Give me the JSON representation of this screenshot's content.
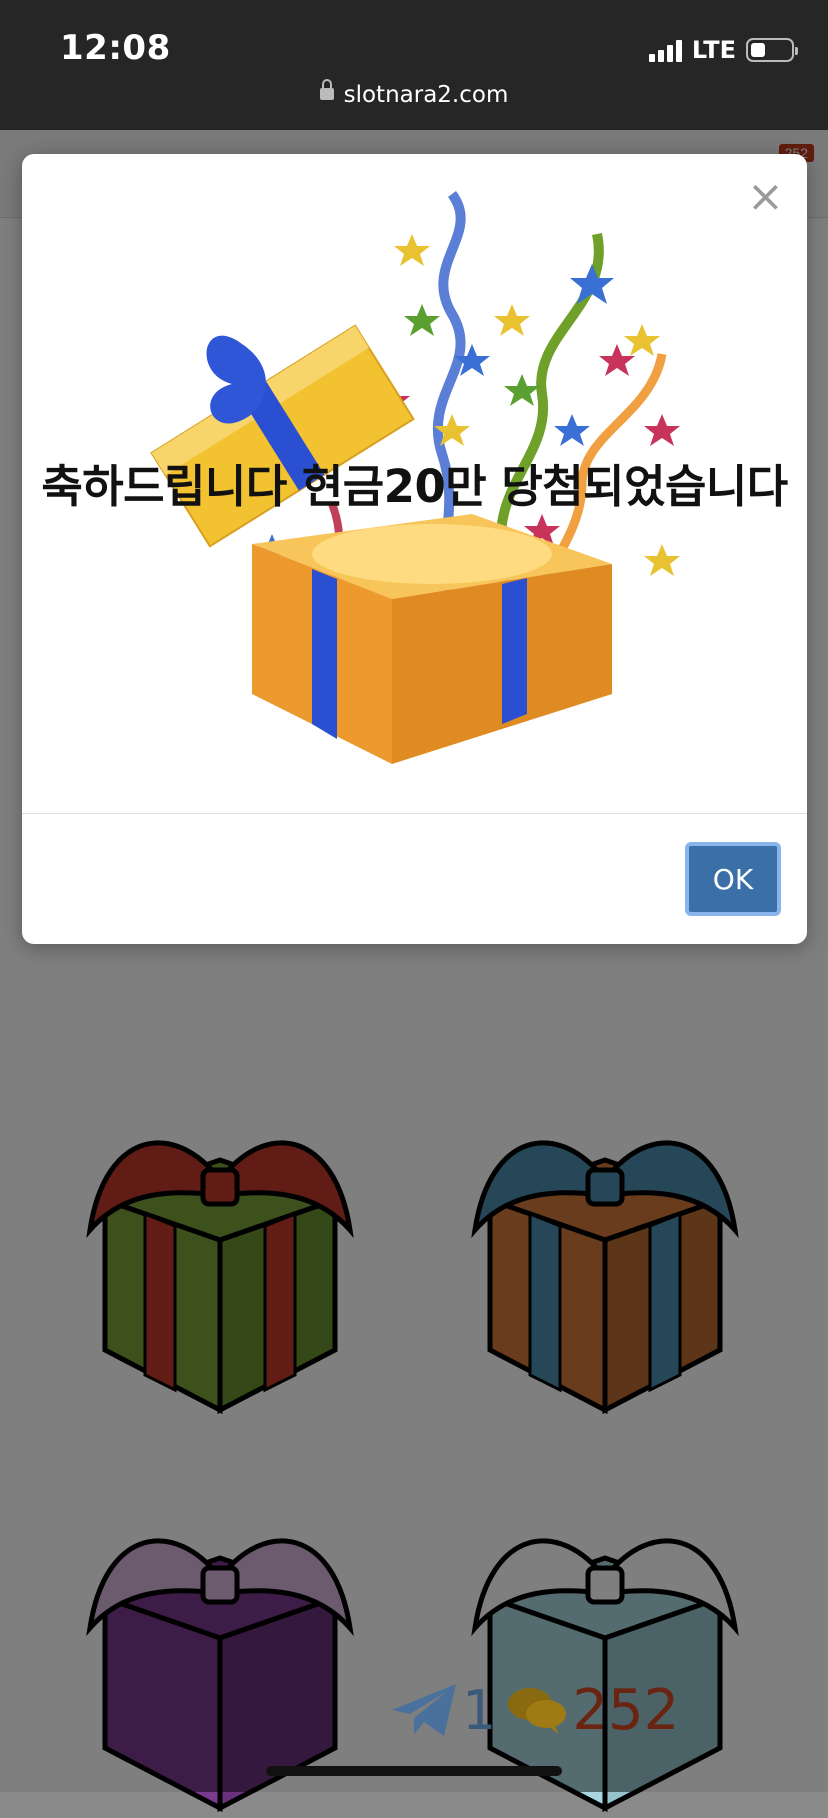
{
  "status": {
    "time": "12:08",
    "network": "LTE",
    "url": "slotnara2.com"
  },
  "page": {
    "header_badge": "252",
    "telegram_count": "1",
    "chat_count": "252"
  },
  "modal": {
    "message": "축하드립니다 현금20만 당첨되었습니다",
    "close_label": "×",
    "ok_label": "OK"
  },
  "colors": {
    "ok_button": "#3a6fa8",
    "overlay": "rgba(0,0,0,0.5)"
  },
  "icons": [
    "lock-icon",
    "close-icon",
    "telegram-icon",
    "chat-icon",
    "gift-box-icon"
  ]
}
